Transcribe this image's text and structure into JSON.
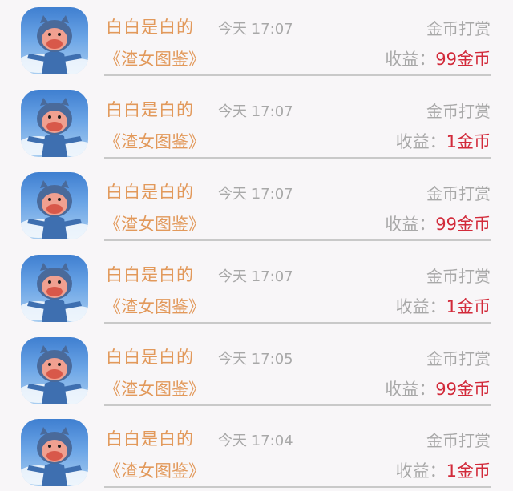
{
  "records": [
    {
      "name": "白白是白的",
      "time": "今天 17:07",
      "type": "金币打赏",
      "title": "《渣女图鉴》",
      "earn_label": "收益：",
      "earn_value": "99金币"
    },
    {
      "name": "白白是白的",
      "time": "今天 17:07",
      "type": "金币打赏",
      "title": "《渣女图鉴》",
      "earn_label": "收益：",
      "earn_value": "1金币"
    },
    {
      "name": "白白是白的",
      "time": "今天 17:07",
      "type": "金币打赏",
      "title": "《渣女图鉴》",
      "earn_label": "收益：",
      "earn_value": "99金币"
    },
    {
      "name": "白白是白的",
      "time": "今天 17:07",
      "type": "金币打赏",
      "title": "《渣女图鉴》",
      "earn_label": "收益：",
      "earn_value": "1金币"
    },
    {
      "name": "白白是白的",
      "time": "今天 17:05",
      "type": "金币打赏",
      "title": "《渣女图鉴》",
      "earn_label": "收益：",
      "earn_value": "99金币"
    },
    {
      "name": "白白是白的",
      "time": "今天 17:04",
      "type": "金币打赏",
      "title": "《渣女图鉴》",
      "earn_label": "收益：",
      "earn_value": "1金币"
    }
  ],
  "colors": {
    "name": "#e2995b",
    "muted": "#a8a8a8",
    "value": "#d22a3a",
    "background": "#f8f6f8"
  },
  "icons": {
    "avatar": "pig-doll-avatar"
  }
}
